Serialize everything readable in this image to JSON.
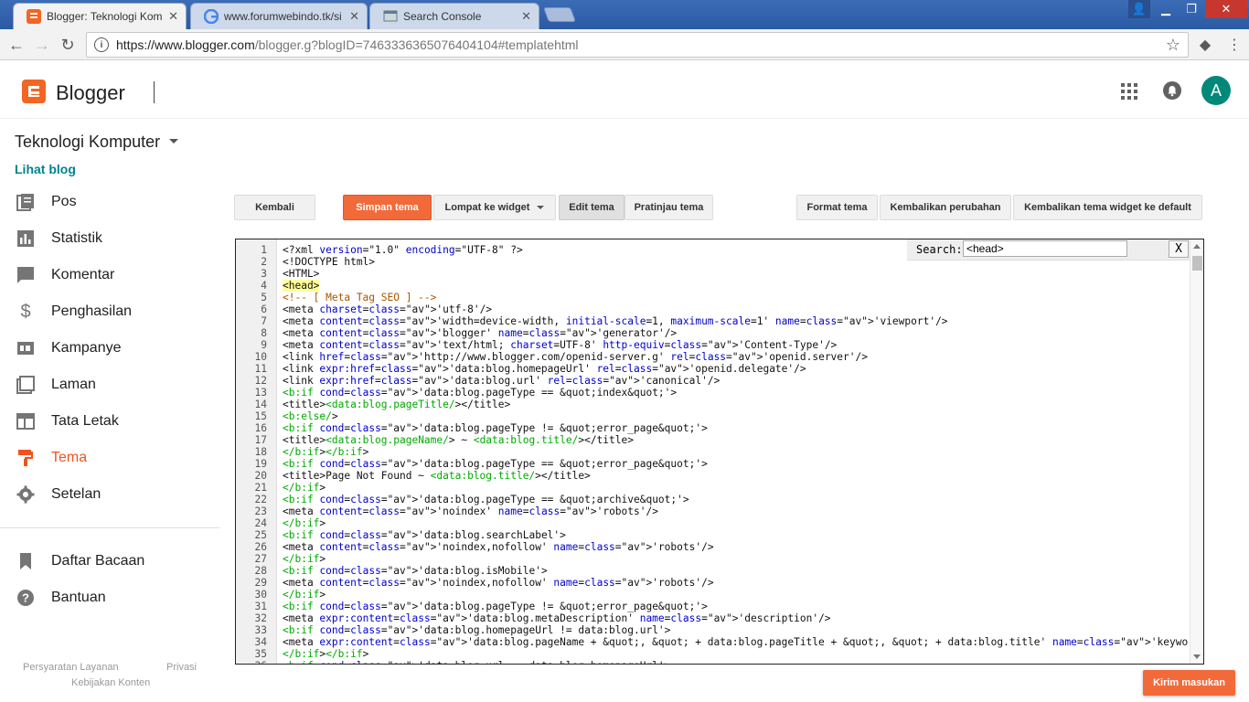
{
  "browser": {
    "tabs": [
      {
        "title": "Blogger: Teknologi Komp",
        "active": true
      },
      {
        "title": "www.forumwebindo.tk/si",
        "active": false
      },
      {
        "title": "Search Console",
        "active": false
      }
    ],
    "url_host": "https://www.blogger.com",
    "url_rest": "/blogger.g?blogID=7463336365076404104#templatehtml"
  },
  "header": {
    "logo_text": "Blogger",
    "avatar_letter": "A"
  },
  "sidebar": {
    "blog_title": "Teknologi Komputer",
    "view_blog": "Lihat blog",
    "items": [
      {
        "label": "Pos",
        "icon": "posts-icon"
      },
      {
        "label": "Statistik",
        "icon": "stats-icon"
      },
      {
        "label": "Komentar",
        "icon": "comments-icon"
      },
      {
        "label": "Penghasilan",
        "icon": "dollar-icon"
      },
      {
        "label": "Kampanye",
        "icon": "ads-icon"
      },
      {
        "label": "Laman",
        "icon": "pages-icon"
      },
      {
        "label": "Tata Letak",
        "icon": "layout-icon"
      },
      {
        "label": "Tema",
        "icon": "theme-icon",
        "active": true
      },
      {
        "label": "Setelan",
        "icon": "gear-icon"
      }
    ],
    "items2": [
      {
        "label": "Daftar Bacaan",
        "icon": "bookmark-icon"
      },
      {
        "label": "Bantuan",
        "icon": "help-icon"
      }
    ],
    "footer": {
      "terms": "Persyaratan Layanan",
      "privacy": "Privasi",
      "content_policy": "Kebijakan Konten"
    }
  },
  "toolbar": {
    "back": "Kembali",
    "save": "Simpan tema",
    "jump": "Lompat ke widget",
    "edit": "Edit tema",
    "preview": "Pratinjau tema",
    "format": "Format tema",
    "revert": "Kembalikan perubahan",
    "reset_widgets": "Kembalikan tema widget ke default"
  },
  "search": {
    "label": "Search:",
    "value": "<head>",
    "close": "X"
  },
  "feedback": "Kirim masukan",
  "code_lines": [
    "<?xml version=\"1.0\" encoding=\"UTF-8\" ?>",
    "<!DOCTYPE html>",
    "<HTML>",
    "<head>",
    "<!-- [ Meta Tag SEO ] -->",
    "<meta charset='utf-8'/>",
    "<meta content='width=device-width, initial-scale=1, maximum-scale=1' name='viewport'/>",
    "<meta content='blogger' name='generator'/>",
    "<meta content='text/html; charset=UTF-8' http-equiv='Content-Type'/>",
    "<link href='http://www.blogger.com/openid-server.g' rel='openid.server'/>",
    "<link expr:href='data:blog.homepageUrl' rel='openid.delegate'/>",
    "<link expr:href='data:blog.url' rel='canonical'/>",
    "<b:if cond='data:blog.pageType == &quot;index&quot;'>",
    "<title><data:blog.pageTitle/></title>",
    "<b:else/>",
    "<b:if cond='data:blog.pageType != &quot;error_page&quot;'>",
    "<title><data:blog.pageName/> ~ <data:blog.title/></title>",
    "</b:if></b:if>",
    "<b:if cond='data:blog.pageType == &quot;error_page&quot;'>",
    "<title>Page Not Found ~ <data:blog.title/></title>",
    "</b:if>",
    "<b:if cond='data:blog.pageType == &quot;archive&quot;'>",
    "<meta content='noindex' name='robots'/>",
    "</b:if>",
    "<b:if cond='data:blog.searchLabel'>",
    "<meta content='noindex,nofollow' name='robots'/>",
    "</b:if>",
    "<b:if cond='data:blog.isMobile'>",
    "<meta content='noindex,nofollow' name='robots'/>",
    "</b:if>",
    "<b:if cond='data:blog.pageType != &quot;error_page&quot;'>",
    "<meta expr:content='data:blog.metaDescription' name='description'/>",
    "<b:if cond='data:blog.homepageUrl != data:blog.url'>",
    "<meta expr:content='data:blog.pageName + &quot;, &quot; + data:blog.pageTitle + &quot;, &quot; + data:blog.title' name='keywords'/>",
    "</b:if></b:if>",
    "<b:if cond='data:blog.url == data:blog.homepageUrl'>"
  ],
  "colors": {
    "accent": "#f26a3a",
    "link": "#00838f",
    "active_nav": "#f4511e",
    "avatar": "#00897b"
  }
}
